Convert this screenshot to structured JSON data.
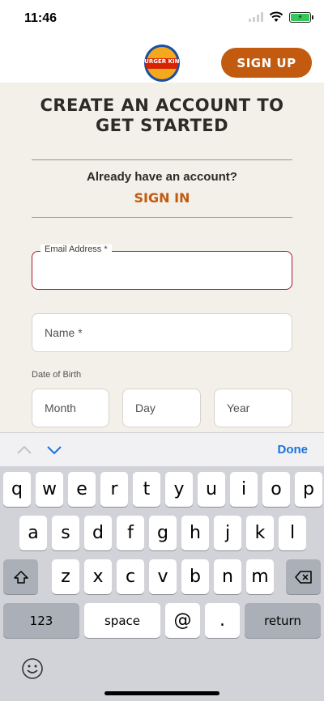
{
  "status": {
    "time": "11:46"
  },
  "header": {
    "logo_alt": "BURGER KING",
    "signup_label": "SIGN UP"
  },
  "content": {
    "title": "CREATE AN ACCOUNT TO GET STARTED",
    "already_text": "Already have an account?",
    "signin_label": "SIGN IN",
    "email_label": "Email Address *",
    "name_placeholder": "Name *",
    "dob_label": "Date of Birth",
    "month_placeholder": "Month",
    "day_placeholder": "Day",
    "year_placeholder": "Year"
  },
  "keyboard": {
    "done_label": "Done",
    "row1": [
      "q",
      "w",
      "e",
      "r",
      "t",
      "y",
      "u",
      "i",
      "o",
      "p"
    ],
    "row2": [
      "a",
      "s",
      "d",
      "f",
      "g",
      "h",
      "j",
      "k",
      "l"
    ],
    "row3": [
      "z",
      "x",
      "c",
      "v",
      "b",
      "n",
      "m"
    ],
    "numbers_label": "123",
    "space_label": "space",
    "at_label": "@",
    "period_label": ".",
    "return_label": "return"
  },
  "colors": {
    "accent": "#c25a0f",
    "error": "#a6192e",
    "link": "#1a73d9"
  }
}
